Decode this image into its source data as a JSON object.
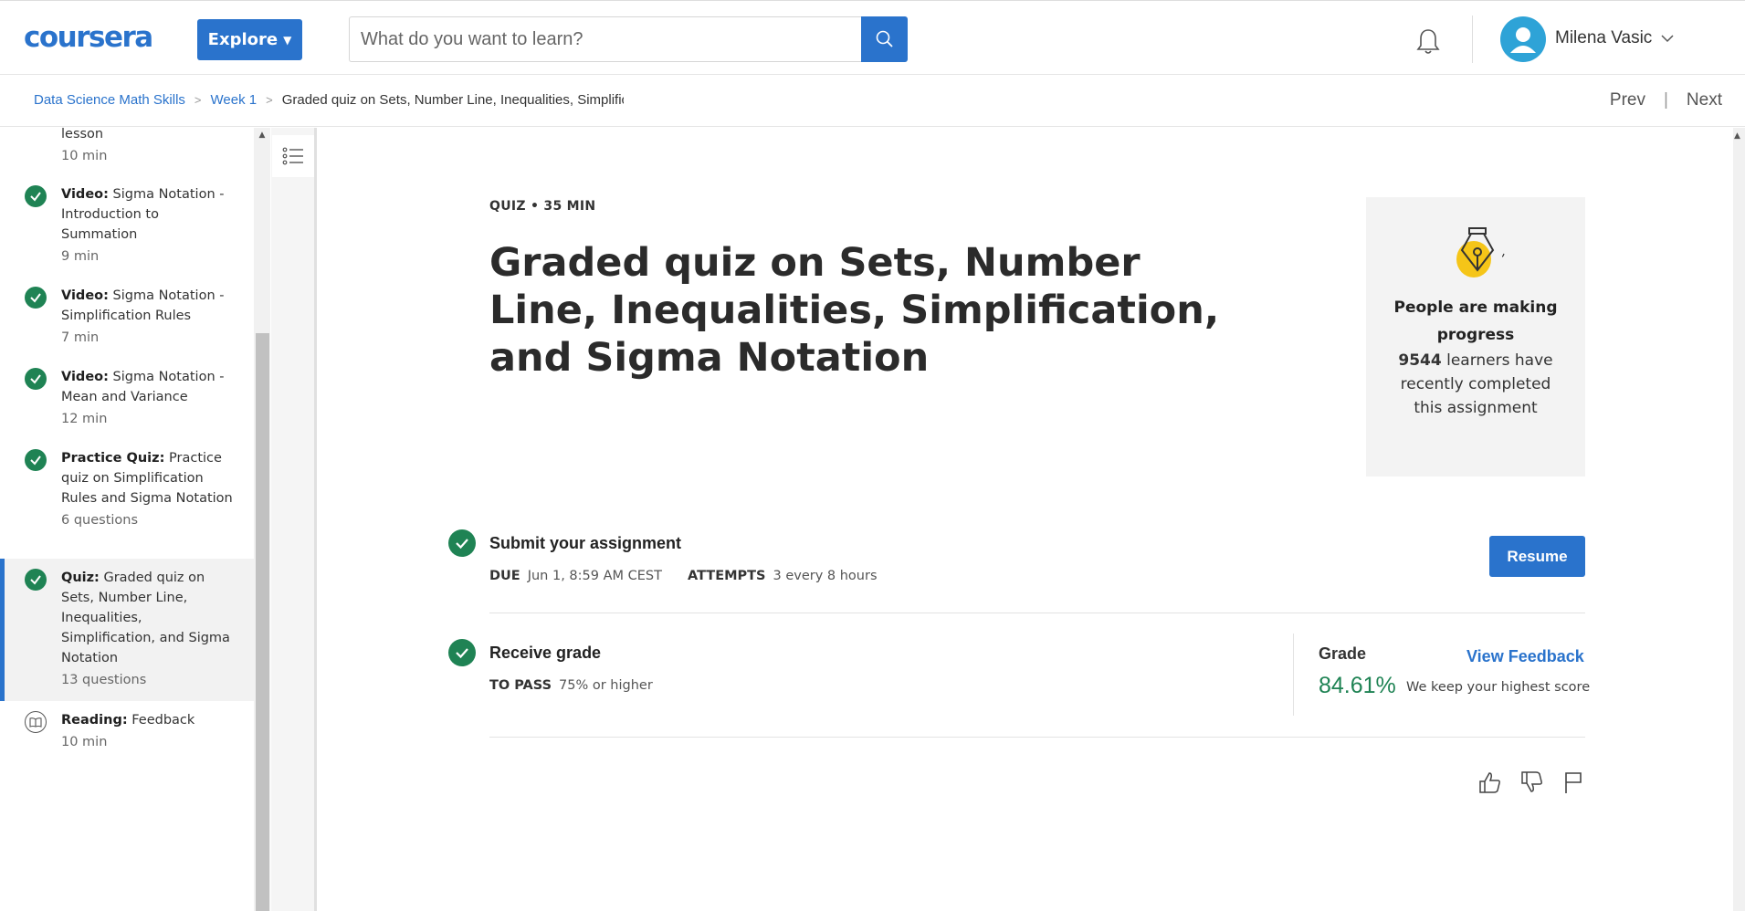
{
  "header": {
    "logo": "coursera",
    "explore_label": "Explore",
    "search_placeholder": "What do you want to learn?",
    "username": "Milena Vasic"
  },
  "breadcrumb": {
    "course": "Data Science Math Skills",
    "week": "Week 1",
    "current": "Graded quiz on Sets, Number Line, Inequalities, Simplification, and Sigma Notation",
    "prev": "Prev",
    "next": "Next",
    "separator": "|"
  },
  "sidebar": {
    "items": [
      {
        "type": "",
        "title": "lesson",
        "meta": "10 min",
        "icon": "check-icon"
      },
      {
        "type": "Video:",
        "title": "Sigma Notation - Introduction to Summation",
        "meta": "9 min",
        "icon": "check-icon"
      },
      {
        "type": "Video:",
        "title": "Sigma Notation - Simplification Rules",
        "meta": "7 min",
        "icon": "check-icon"
      },
      {
        "type": "Video:",
        "title": "Sigma Notation - Mean and Variance",
        "meta": "12 min",
        "icon": "check-icon"
      },
      {
        "type": "Practice Quiz:",
        "title": "Practice quiz on Simplification Rules and Sigma Notation",
        "meta": "6 questions",
        "icon": "check-icon"
      },
      {
        "type": "Quiz:",
        "title": "Graded quiz on Sets, Number Line, Inequalities, Simplification, and Sigma Notation",
        "meta": "13 questions",
        "icon": "check-icon",
        "active": true
      },
      {
        "type": "Reading:",
        "title": "Feedback",
        "meta": "10 min",
        "icon": "book-icon"
      }
    ]
  },
  "main": {
    "quiz_label": "QUIZ • 35 MIN",
    "title": "Graded quiz on Sets, Number Line, Inequalities, Simplification, and Sigma Notation",
    "progress": {
      "heading": "People are making progress",
      "count": "9544",
      "text": "learners have recently completed this assignment"
    },
    "submit": {
      "title": "Submit your assignment",
      "due_label": "DUE",
      "due_value": "Jun 1, 8:59 AM CEST",
      "attempts_label": "ATTEMPTS",
      "attempts_value": "3 every 8 hours",
      "resume_label": "Resume"
    },
    "grade": {
      "title": "Receive grade",
      "to_pass_label": "TO PASS",
      "to_pass_value": "75% or higher",
      "grade_label": "Grade",
      "view_feedback": "View Feedback",
      "grade_value": "84.61%",
      "note": "We keep your highest score"
    }
  },
  "colors": {
    "brand": "#2a73cc",
    "success": "#1f8354",
    "highlight_yellow": "#f5c518"
  }
}
